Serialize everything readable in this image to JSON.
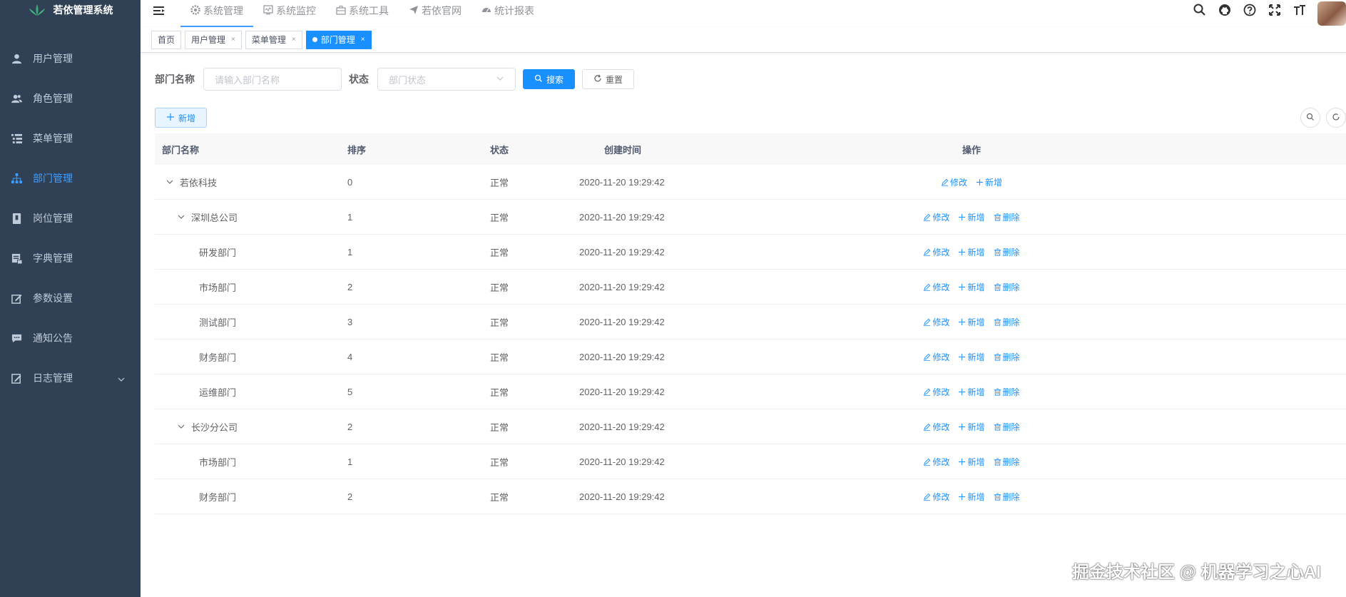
{
  "app": {
    "title": "若依管理系统"
  },
  "sidebar": {
    "items": [
      {
        "label": "用户管理",
        "icon": "user-icon",
        "active": false
      },
      {
        "label": "角色管理",
        "icon": "peoples-icon",
        "active": false
      },
      {
        "label": "菜单管理",
        "icon": "tree-table-icon",
        "active": false
      },
      {
        "label": "部门管理",
        "icon": "tree-icon",
        "active": true
      },
      {
        "label": "岗位管理",
        "icon": "post-icon",
        "active": false
      },
      {
        "label": "字典管理",
        "icon": "dict-icon",
        "active": false
      },
      {
        "label": "参数设置",
        "icon": "edit-icon",
        "active": false
      },
      {
        "label": "通知公告",
        "icon": "message-icon",
        "active": false
      },
      {
        "label": "日志管理",
        "icon": "log-icon",
        "active": false,
        "expandable": true
      }
    ]
  },
  "topmenu": {
    "items": [
      {
        "label": "系统管理",
        "icon": "gear-icon",
        "active": true
      },
      {
        "label": "系统监控",
        "icon": "monitor-icon",
        "active": false
      },
      {
        "label": "系统工具",
        "icon": "tool-icon",
        "active": false
      },
      {
        "label": "若依官网",
        "icon": "send-icon",
        "active": false
      },
      {
        "label": "统计报表",
        "icon": "dashboard-icon",
        "active": false
      }
    ]
  },
  "tags": {
    "items": [
      {
        "label": "首页",
        "closable": false,
        "active": false
      },
      {
        "label": "用户管理",
        "closable": true,
        "active": false
      },
      {
        "label": "菜单管理",
        "closable": true,
        "active": false
      },
      {
        "label": "部门管理",
        "closable": true,
        "active": true
      }
    ],
    "close_glyph": "×"
  },
  "search": {
    "dept_label": "部门名称",
    "dept_placeholder": "请输入部门名称",
    "status_label": "状态",
    "status_placeholder": "部门状态",
    "search_button": "搜索",
    "reset_button": "重置"
  },
  "toolbar": {
    "add_button": "新增"
  },
  "table": {
    "headers": [
      "部门名称",
      "排序",
      "状态",
      "创建时间",
      "操作"
    ],
    "rows": [
      {
        "name": "若依科技",
        "sort": "0",
        "status": "正常",
        "created": "2020-11-20 19:29:42",
        "level": 1,
        "expandable": true,
        "ops": [
          "修改",
          "新增"
        ]
      },
      {
        "name": "深圳总公司",
        "sort": "1",
        "status": "正常",
        "created": "2020-11-20 19:29:42",
        "level": 2,
        "expandable": true,
        "ops": [
          "修改",
          "新增",
          "删除"
        ]
      },
      {
        "name": "研发部门",
        "sort": "1",
        "status": "正常",
        "created": "2020-11-20 19:29:42",
        "level": 3,
        "expandable": false,
        "ops": [
          "修改",
          "新增",
          "删除"
        ]
      },
      {
        "name": "市场部门",
        "sort": "2",
        "status": "正常",
        "created": "2020-11-20 19:29:42",
        "level": 3,
        "expandable": false,
        "ops": [
          "修改",
          "新增",
          "删除"
        ]
      },
      {
        "name": "测试部门",
        "sort": "3",
        "status": "正常",
        "created": "2020-11-20 19:29:42",
        "level": 3,
        "expandable": false,
        "ops": [
          "修改",
          "新增",
          "删除"
        ]
      },
      {
        "name": "财务部门",
        "sort": "4",
        "status": "正常",
        "created": "2020-11-20 19:29:42",
        "level": 3,
        "expandable": false,
        "ops": [
          "修改",
          "新增",
          "删除"
        ]
      },
      {
        "name": "运维部门",
        "sort": "5",
        "status": "正常",
        "created": "2020-11-20 19:29:42",
        "level": 3,
        "expandable": false,
        "ops": [
          "修改",
          "新增",
          "删除"
        ]
      },
      {
        "name": "长沙分公司",
        "sort": "2",
        "status": "正常",
        "created": "2020-11-20 19:29:42",
        "level": 2,
        "expandable": true,
        "ops": [
          "修改",
          "新增",
          "删除"
        ]
      },
      {
        "name": "市场部门",
        "sort": "1",
        "status": "正常",
        "created": "2020-11-20 19:29:42",
        "level": 3,
        "expandable": false,
        "ops": [
          "修改",
          "新增",
          "删除"
        ]
      },
      {
        "name": "财务部门",
        "sort": "2",
        "status": "正常",
        "created": "2020-11-20 19:29:42",
        "level": 3,
        "expandable": false,
        "ops": [
          "修改",
          "新增",
          "删除"
        ]
      }
    ]
  },
  "watermark": "掘金技术社区 @ 机器学习之心AI",
  "colors": {
    "sidebar_bg": "#304156",
    "sidebar_text": "#bfcbd9",
    "accent": "#1890ff",
    "active_menu": "#409eff"
  }
}
